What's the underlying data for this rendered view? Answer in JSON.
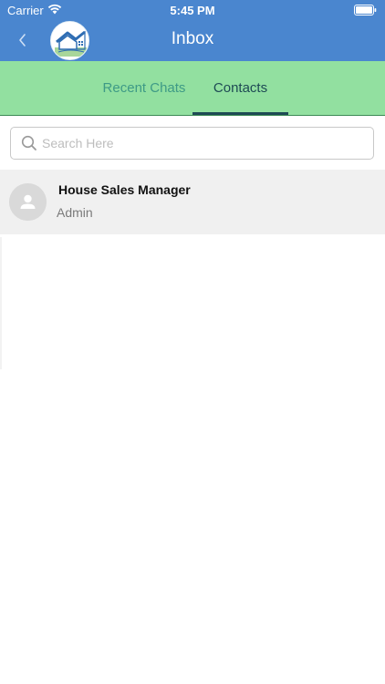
{
  "status_bar": {
    "carrier": "Carrier",
    "time": "5:45 PM"
  },
  "nav": {
    "title": "Inbox",
    "back_icon": "chevron-left-icon",
    "logo_icon": "house-logo-icon"
  },
  "tabs": [
    {
      "label": "Recent Chats",
      "active": false
    },
    {
      "label": "Contacts",
      "active": true
    }
  ],
  "search": {
    "placeholder": "Search Here",
    "value": ""
  },
  "contacts": [
    {
      "name": "House Sales Manager",
      "role": "Admin",
      "avatar_icon": "person-icon"
    }
  ],
  "colors": {
    "header": "#4a86cf",
    "tab_bar": "#92e0a0",
    "tab_active": "#1e4a54",
    "tab_inactive": "#3e9a86",
    "row_bg": "#f0f0f0"
  }
}
